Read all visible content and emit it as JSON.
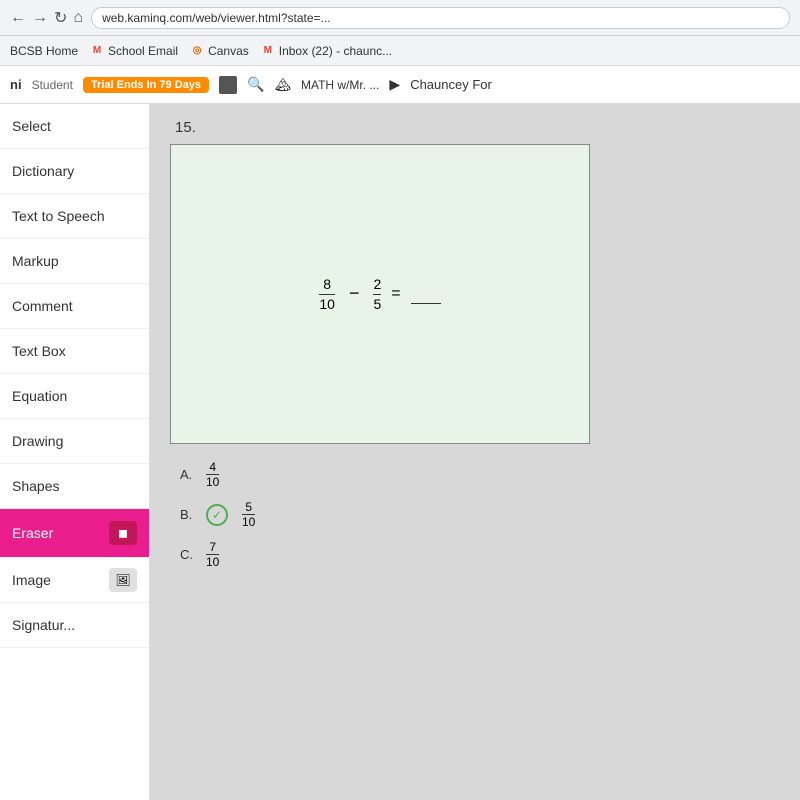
{
  "browser": {
    "url": "web.kaminq.com/web/viewer.html?state=...",
    "nav_back": "←",
    "nav_forward": "→",
    "nav_refresh": "↻",
    "nav_home": "⌂"
  },
  "bookmarks": [
    {
      "id": "bcsb",
      "label": "BCSB Home",
      "icon": "",
      "icon_color": ""
    },
    {
      "id": "school-email",
      "label": "School Email",
      "icon": "M",
      "icon_color": "#EA4335"
    },
    {
      "id": "canvas",
      "label": "Canvas",
      "icon": "◎",
      "icon_color": "#E66000"
    },
    {
      "id": "inbox",
      "label": "Inbox (22) - chaunc...",
      "icon": "M",
      "icon_color": "#EA4335"
    }
  ],
  "toolbar": {
    "logo": "ni",
    "role": "Student",
    "trial": "Trial Ends In 79 Days",
    "search_icon": "🔍",
    "subject": "MATH w/Mr. ...",
    "arrow": "▶",
    "user": "Chauncey For"
  },
  "sidebar": {
    "items": [
      {
        "id": "select",
        "label": "Select",
        "icon": ""
      },
      {
        "id": "dictionary",
        "label": "Dictionary",
        "icon": ""
      },
      {
        "id": "text-to-speech",
        "label": "Text to Speech",
        "icon": ""
      },
      {
        "id": "markup",
        "label": "Markup",
        "icon": ""
      },
      {
        "id": "comment",
        "label": "Comment",
        "icon": ""
      },
      {
        "id": "text-box",
        "label": "Text Box",
        "icon": ""
      },
      {
        "id": "equation",
        "label": "Equation",
        "icon": ""
      },
      {
        "id": "drawing",
        "label": "Drawing",
        "icon": ""
      },
      {
        "id": "shapes",
        "label": "Shapes",
        "icon": ""
      }
    ],
    "eraser": {
      "label": "Eraser",
      "btn_icon": "⬛"
    },
    "image": {
      "label": "Image",
      "btn_icon": "🖼"
    },
    "signature": {
      "label": "Signatur..."
    }
  },
  "content": {
    "question_number": "15.",
    "equation": {
      "numerator1": "8",
      "denominator1": "10",
      "numerator2": "2",
      "denominator2": "5",
      "operator": "−",
      "equals": "="
    },
    "answers": [
      {
        "letter": "A.",
        "numerator": "4",
        "denominator": "10"
      },
      {
        "letter": "B.",
        "numerator": "5",
        "denominator": "10",
        "selected": true
      },
      {
        "letter": "C.",
        "numerator": "7",
        "denominator": "10"
      }
    ]
  }
}
